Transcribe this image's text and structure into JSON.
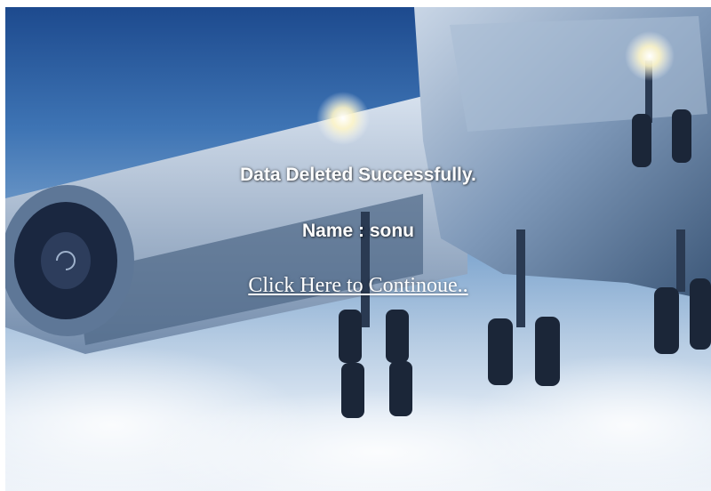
{
  "message": {
    "status_text": "Data Deleted Successfully.",
    "name_label": "Name",
    "name_separator": " : ",
    "name_value": "sonu"
  },
  "link": {
    "continue_label": "Click Here to Continoue.."
  },
  "colors": {
    "text": "#ffffff",
    "sky_top": "#1d4a8e",
    "sky_bottom": "#eef3f9"
  },
  "background": {
    "icon": "airplane-background-image"
  }
}
